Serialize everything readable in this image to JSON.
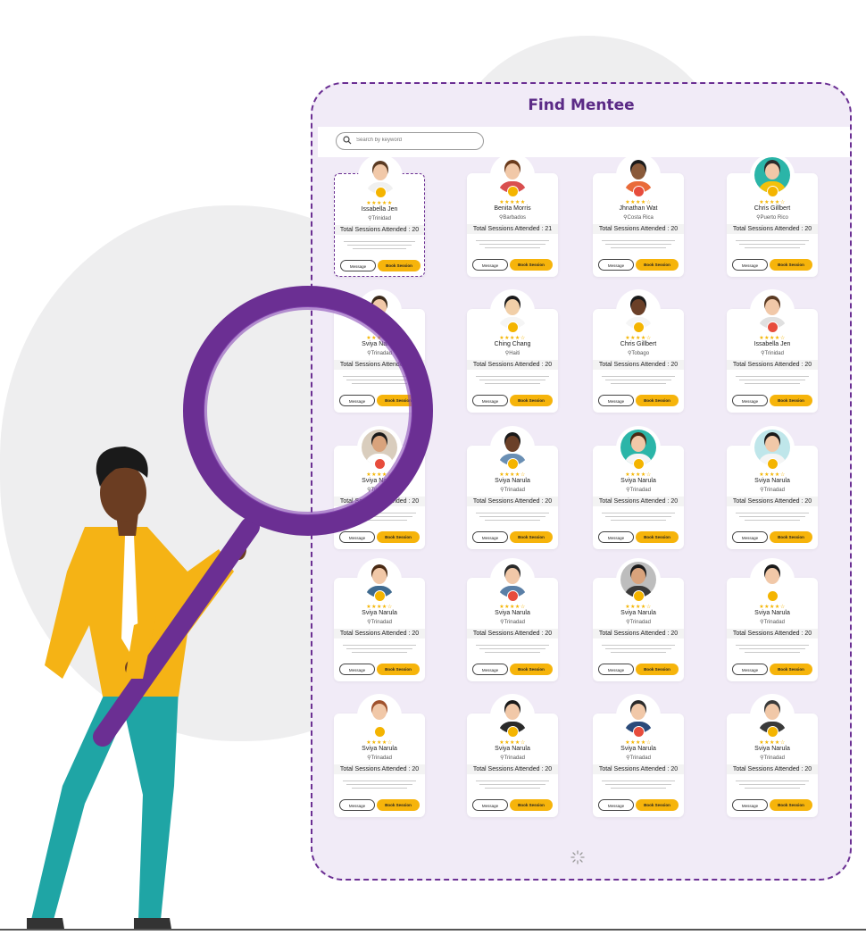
{
  "page": {
    "title": "Find Mentee"
  },
  "search": {
    "placeholder": "Search by keyword"
  },
  "buttons": {
    "message": "Message",
    "book": "Book Session"
  },
  "colors": {
    "accent": "#6b2f93",
    "button": "#f6b40b",
    "star": "#f4b400"
  },
  "mentees": [
    {
      "name": "Issabella Jen",
      "location": "Trinidad",
      "sessions": "Total Sessions Attended : 20",
      "rating": 5,
      "selected": true,
      "skin": "#f1c8a8",
      "hair": "#5a3a22",
      "shirt": "#f0f0f0",
      "bg": "#ffffff",
      "badge": "#f4b400"
    },
    {
      "name": "Benita Morris",
      "location": "Barbados",
      "sessions": "Total Sessions Attended : 21",
      "rating": 5,
      "skin": "#f1c8a8",
      "hair": "#6b3b1c",
      "shirt": "#d94f4f",
      "bg": "#ffffff",
      "badge": "#f4b400"
    },
    {
      "name": "Jhnathan Wat",
      "location": "Costa Rica",
      "sessions": "Total Sessions Attended : 20",
      "rating": 4,
      "skin": "#8a5a3a",
      "hair": "#1a1a1a",
      "shirt": "#e96b3a",
      "bg": "#ffffff",
      "badge": "#e74c3c"
    },
    {
      "name": "Chris Gillbert",
      "location": "Puerto Rico",
      "sessions": "Total Sessions Attended : 20",
      "rating": 4,
      "skin": "#f1c8a8",
      "hair": "#2b2b2b",
      "shirt": "#f3c10b",
      "bg": "#2bb5a8",
      "badge": "#f4b400"
    },
    {
      "name": "Sviya Narula",
      "location": "Trinadad",
      "sessions": "Total Sessions Attended : 20",
      "rating": 4,
      "skin": "#f1c8a8",
      "hair": "#3a2a1a",
      "shirt": "#ffffff",
      "bg": "#ffffff",
      "badge": "#e74c3c"
    },
    {
      "name": "Ching Chang",
      "location": "Haiti",
      "sessions": "Total Sessions Attended : 20",
      "rating": 4,
      "skin": "#f1cfa8",
      "hair": "#1a1a1a",
      "shirt": "#f5f5f5",
      "bg": "#ffffff",
      "badge": "#f4b400"
    },
    {
      "name": "Chris Gillbert",
      "location": "Tobago",
      "sessions": "Total Sessions Attended : 20",
      "rating": 4,
      "skin": "#6b4028",
      "hair": "#1a1a1a",
      "shirt": "#f5f5f5",
      "bg": "#ffffff",
      "badge": "#f4b400"
    },
    {
      "name": "Issabella Jen",
      "location": "Trinidad",
      "sessions": "Total Sessions Attended : 20",
      "rating": 4,
      "skin": "#f1c8a8",
      "hair": "#5a3a22",
      "shirt": "#e0e0e0",
      "bg": "#ffffff",
      "badge": "#e74c3c"
    },
    {
      "name": "Sviya Narula",
      "location": "Trinadad",
      "sessions": "Total Sessions Attended : 20",
      "rating": 4,
      "skin": "#d9a37c",
      "hair": "#1a1a1a",
      "shirt": "#ffffff",
      "bg": "#d9cdbd",
      "badge": "#e74c3c"
    },
    {
      "name": "Sviya Narula",
      "location": "Trinadad",
      "sessions": "Total Sessions Attended : 20",
      "rating": 4,
      "skin": "#6b4028",
      "hair": "#1a1a1a",
      "shirt": "#6a8fb4",
      "bg": "#ffffff",
      "badge": "#f4b400"
    },
    {
      "name": "Sviya Narula",
      "location": "Trinadad",
      "sessions": "Total Sessions Attended : 20",
      "rating": 4,
      "skin": "#f1c8a8",
      "hair": "#4a2a14",
      "shirt": "#f5f5f5",
      "bg": "#2bb5a8",
      "badge": "#f4b400"
    },
    {
      "name": "Sviya Narula",
      "location": "Trinadad",
      "sessions": "Total Sessions Attended : 20",
      "rating": 4,
      "skin": "#f1c8a8",
      "hair": "#1a1a1a",
      "shirt": "#f5f5f5",
      "bg": "#bfe6ea",
      "badge": "#f4b400"
    },
    {
      "name": "Sviya Narula",
      "location": "Trinadad",
      "sessions": "Total Sessions Attended : 20",
      "rating": 4,
      "skin": "#f1c8a8",
      "hair": "#4a2a14",
      "shirt": "#3f6a8f",
      "bg": "#ffffff",
      "badge": "#f4b400"
    },
    {
      "name": "Sviya Narula",
      "location": "Trinadad",
      "sessions": "Total Sessions Attended : 20",
      "rating": 4,
      "skin": "#f1c8a8",
      "hair": "#2a2a2a",
      "shirt": "#5a7fa6",
      "bg": "#ffffff",
      "badge": "#e74c3c"
    },
    {
      "name": "Sviya Narula",
      "location": "Trinadad",
      "sessions": "Total Sessions Attended : 20",
      "rating": 4,
      "skin": "#d9a37c",
      "hair": "#1a1a1a",
      "shirt": "#3a3a3a",
      "bg": "#bdbdbd",
      "badge": "#f4b400"
    },
    {
      "name": "Sviya Narula",
      "location": "Trinadad",
      "sessions": "Total Sessions Attended : 20",
      "rating": 4,
      "skin": "#f1c8a8",
      "hair": "#1a1a1a",
      "shirt": "#ffffff",
      "bg": "#ffffff",
      "badge": "#f4b400"
    },
    {
      "name": "Sviya Narula",
      "location": "Trinadad",
      "sessions": "Total Sessions Attended : 20",
      "rating": 4,
      "skin": "#f1c8a8",
      "hair": "#a0522d",
      "shirt": "#ffffff",
      "bg": "#ffffff",
      "badge": "#f4b400"
    },
    {
      "name": "Sviya Narula",
      "location": "Trinadad",
      "sessions": "Total Sessions Attended : 20",
      "rating": 4,
      "skin": "#f1c8a8",
      "hair": "#1a1a1a",
      "shirt": "#2a2a2a",
      "bg": "#ffffff",
      "badge": "#f4b400"
    },
    {
      "name": "Sviya Narula",
      "location": "Trinadad",
      "sessions": "Total Sessions Attended : 20",
      "rating": 4,
      "skin": "#f1c8a8",
      "hair": "#2a2a2a",
      "shirt": "#2a4a7a",
      "bg": "#ffffff",
      "badge": "#e74c3c"
    },
    {
      "name": "Sviya Narula",
      "location": "Trinadad",
      "sessions": "Total Sessions Attended : 20",
      "rating": 4,
      "skin": "#f1c8a8",
      "hair": "#3a3a3a",
      "shirt": "#3a3a3a",
      "bg": "#ffffff",
      "badge": "#f4b400"
    }
  ]
}
